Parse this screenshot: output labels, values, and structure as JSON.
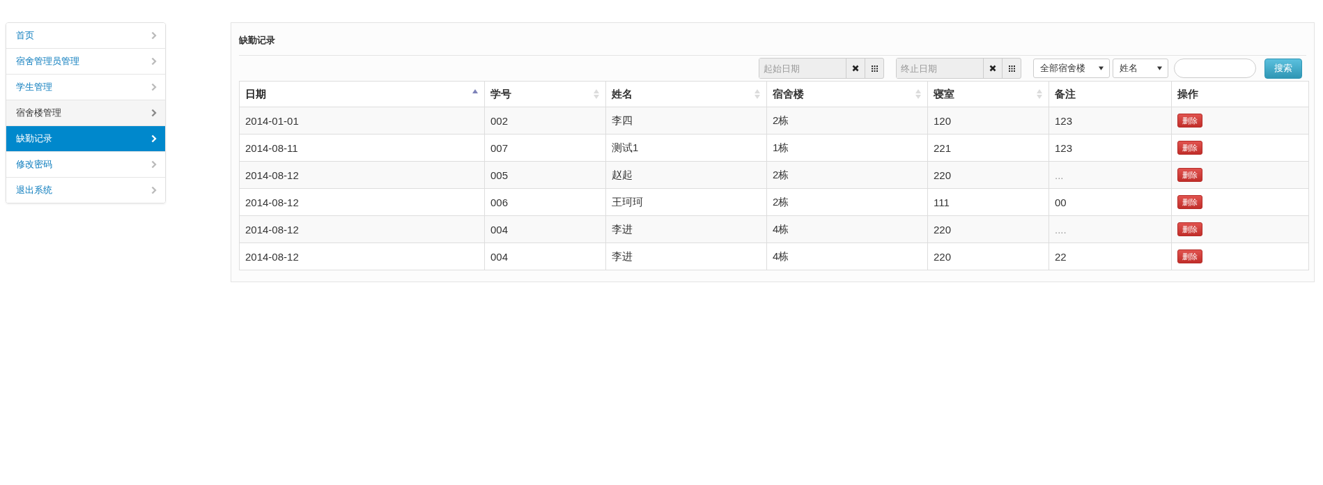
{
  "sidebar": {
    "items": [
      {
        "label": "首页",
        "selected": false,
        "highlighted": false
      },
      {
        "label": "宿舍管理员管理",
        "selected": false,
        "highlighted": false
      },
      {
        "label": "学生管理",
        "selected": false,
        "highlighted": false
      },
      {
        "label": "宿舍楼管理",
        "selected": false,
        "highlighted": true
      },
      {
        "label": "缺勤记录",
        "selected": true,
        "highlighted": false
      },
      {
        "label": "修改密码",
        "selected": false,
        "highlighted": false
      },
      {
        "label": "退出系统",
        "selected": false,
        "highlighted": false
      }
    ]
  },
  "panel": {
    "title": "缺勤记录",
    "toolbar": {
      "start_date": {
        "placeholder": "起始日期"
      },
      "end_date": {
        "placeholder": "终止日期"
      },
      "building_select": {
        "value": "全部宿舍楼"
      },
      "field_select": {
        "value": "姓名"
      },
      "search_button": "搜索"
    },
    "table": {
      "columns": [
        {
          "label": "日期",
          "sortable": true,
          "sorted": true
        },
        {
          "label": "学号",
          "sortable": true,
          "sorted": false
        },
        {
          "label": "姓名",
          "sortable": true,
          "sorted": false
        },
        {
          "label": "宿舍楼",
          "sortable": true,
          "sorted": false
        },
        {
          "label": "寝室",
          "sortable": true,
          "sorted": false
        },
        {
          "label": "备注",
          "sortable": false,
          "sorted": false
        },
        {
          "label": "操作",
          "sortable": false,
          "sorted": false
        }
      ],
      "rows": [
        {
          "cells": [
            "2014-01-01",
            "002",
            "李四",
            "2栋",
            "120",
            "123"
          ],
          "action": "删除"
        },
        {
          "cells": [
            "2014-08-11",
            "007",
            "测试1",
            "1栋",
            "221",
            "123"
          ],
          "action": "删除"
        },
        {
          "cells": [
            "2014-08-12",
            "005",
            "赵起",
            "2栋",
            "220",
            "..."
          ],
          "action": "删除"
        },
        {
          "cells": [
            "2014-08-12",
            "006",
            "王珂珂",
            "2栋",
            "111",
            "00"
          ],
          "action": "删除"
        },
        {
          "cells": [
            "2014-08-12",
            "004",
            "李进",
            "4栋",
            "220",
            "...."
          ],
          "action": "删除"
        },
        {
          "cells": [
            "2014-08-12",
            "004",
            "李进",
            "4栋",
            "220",
            "22"
          ],
          "action": "删除"
        }
      ]
    }
  }
}
